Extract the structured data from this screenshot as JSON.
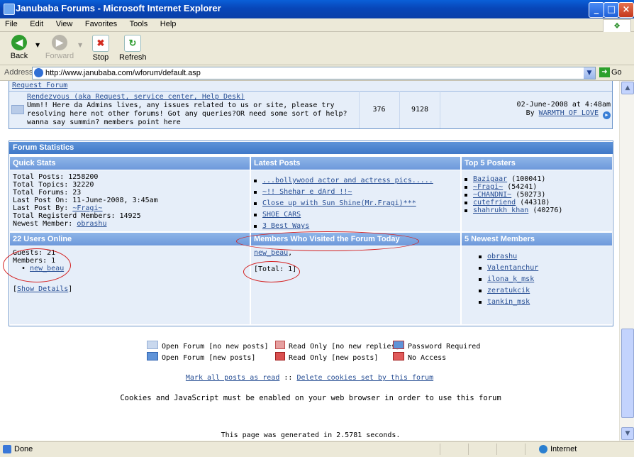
{
  "window": {
    "title": "Janubaba Forums - Microsoft Internet Explorer"
  },
  "menu": [
    "File",
    "Edit",
    "View",
    "Favorites",
    "Tools",
    "Help"
  ],
  "toolbar": {
    "back": "Back",
    "forward": "Forward",
    "stop": "Stop",
    "refresh": "Refresh"
  },
  "address": {
    "label": "Address",
    "url": "http://www.janubaba.com/wforum/default.asp",
    "go": "Go"
  },
  "forum_row": {
    "category_link": "Request Forum",
    "title": "Rendezvous (aka Request, service center, Help Desk)",
    "description": "Umm!! Here da Admins lives, any issues related to us or site, please try resolving here not other forums! Got any queries?OR need some sort of help? wanna say summin? members point here",
    "topics": "376",
    "posts": "9128",
    "last_post_date": "02-June-2008 at 4:48am",
    "last_post_by_prefix": "By",
    "last_post_by": "WARMTH OF LOVE"
  },
  "stats": {
    "header": "Forum Statistics",
    "quick_stats_header": "Quick Stats",
    "latest_posts_header": "Latest Posts",
    "top_posters_header": "Top 5 Posters",
    "quick_stats": [
      "Total Posts: 1258200",
      "Total Topics: 32220",
      "Total Forums: 23",
      "Last Post On: 11-June-2008, 3:45am"
    ],
    "last_post_by_label": "Last Post By:",
    "last_post_by_user": "~Fragi~",
    "registered_members": "Total Registerd Members: 14925",
    "newest_member_label": "Newest Member:",
    "newest_member": "obrashu",
    "latest_posts": [
      "...bollywood actor and actress pics.....",
      "~!! Shehar e dArd !!~",
      "Close up with Sun Shine(Mr.Fragi)***",
      "SHOE CARS",
      "3 Best Ways"
    ],
    "top_posters": [
      {
        "name": "Bazigaar",
        "count": "(100041)"
      },
      {
        "name": "~Fragi~",
        "count": "(54241)"
      },
      {
        "name": "~CHANDNI~",
        "count": "(50273)"
      },
      {
        "name": "cutefriend",
        "count": "(44318)"
      },
      {
        "name": "shahrukh khan",
        "count": "(40276)"
      }
    ],
    "users_online_header": "22 Users Online",
    "visited_header": "Members Who Visited the Forum Today",
    "newest_members_header": "5 Newest Members",
    "guests": "Guests: 21",
    "members": "Members: 1",
    "online_member": "new_beau",
    "show_details_open": "[",
    "show_details": "Show Details",
    "show_details_close": "]",
    "visited_member": "new_beau",
    "visited_sep": ",",
    "visited_total": "[Total: 1]",
    "newest_members": [
      "obrashu",
      "Valentanchur",
      "ilona_k_msk",
      "zeratukcik",
      "tankin_msk"
    ]
  },
  "legend": {
    "open_no_new": "Open Forum [no new posts]",
    "open_new": "Open Forum [new posts]",
    "readonly_no_new": "Read Only [no new replies]",
    "readonly_new": "Read Only [new posts]",
    "password": "Password Required",
    "no_access": "No Access"
  },
  "footer": {
    "mark_read": "Mark all posts as read",
    "separator": "::",
    "delete_cookies": "Delete cookies set by this forum",
    "cookies_notice": "Cookies and JavaScript must be enabled on your web browser in order to use this forum",
    "generated": "This page was generated in 2.5781 seconds."
  },
  "status": {
    "text": "Done",
    "zone": "Internet"
  },
  "colors": {
    "accent": "#3f78c8",
    "link": "#274e94",
    "annotation": "#d42020"
  }
}
